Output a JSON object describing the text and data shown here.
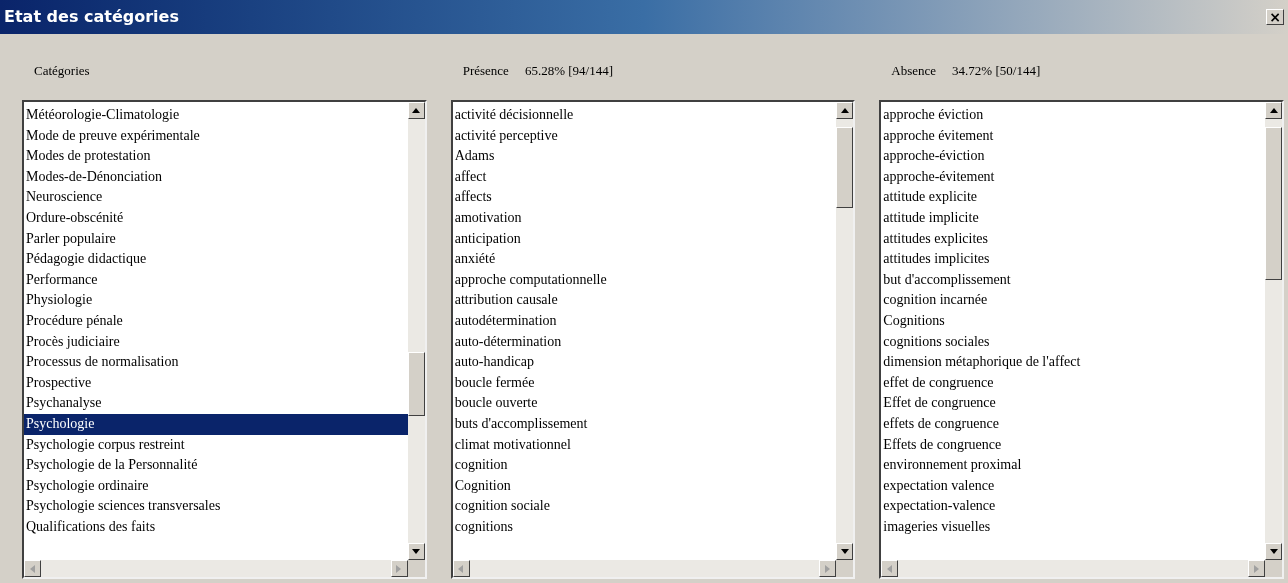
{
  "window": {
    "title": "Etat des catégories",
    "close": "×"
  },
  "panels": [
    {
      "label": "Catégories",
      "items": [
        {
          "text": "Météorologie-Climatologie",
          "selected": false
        },
        {
          "text": "Mode de preuve expérimentale",
          "selected": false
        },
        {
          "text": "Modes de protestation",
          "selected": false
        },
        {
          "text": "Modes-de-Dénonciation",
          "selected": false
        },
        {
          "text": "Neuroscience",
          "selected": false
        },
        {
          "text": "Ordure-obscénité",
          "selected": false
        },
        {
          "text": "Parler populaire",
          "selected": false
        },
        {
          "text": "Pédagogie didactique",
          "selected": false
        },
        {
          "text": "Performance",
          "selected": false
        },
        {
          "text": "Physiologie",
          "selected": false
        },
        {
          "text": "Procédure pénale",
          "selected": false
        },
        {
          "text": "Procès judiciaire",
          "selected": false
        },
        {
          "text": "Processus de normalisation",
          "selected": false
        },
        {
          "text": "Prospective",
          "selected": false
        },
        {
          "text": "Psychanalyse",
          "selected": false
        },
        {
          "text": "Psychologie",
          "selected": true
        },
        {
          "text": "Psychologie corpus restreint",
          "selected": false
        },
        {
          "text": "Psychologie de la Personnalité",
          "selected": false
        },
        {
          "text": "Psychologie ordinaire",
          "selected": false
        },
        {
          "text": "Psychologie sciences transversales",
          "selected": false
        },
        {
          "text": "Qualifications des faits",
          "selected": false
        }
      ]
    },
    {
      "label": "Présence",
      "stat": "65.28% [94/144]",
      "items": [
        {
          "text": "activité décisionnelle"
        },
        {
          "text": "activité perceptive"
        },
        {
          "text": "Adams"
        },
        {
          "text": "affect"
        },
        {
          "text": "affects"
        },
        {
          "text": "amotivation"
        },
        {
          "text": "anticipation"
        },
        {
          "text": "anxiété"
        },
        {
          "text": "approche computationnelle"
        },
        {
          "text": "attribution causale"
        },
        {
          "text": "autodétermination"
        },
        {
          "text": "auto-détermination"
        },
        {
          "text": "auto-handicap"
        },
        {
          "text": "boucle fermée"
        },
        {
          "text": "boucle ouverte"
        },
        {
          "text": "buts d'accomplissement"
        },
        {
          "text": "climat motivationnel"
        },
        {
          "text": "cognition"
        },
        {
          "text": "Cognition"
        },
        {
          "text": "cognition sociale"
        },
        {
          "text": "cognitions"
        }
      ]
    },
    {
      "label": "Absence",
      "stat": "34.72% [50/144]",
      "items": [
        {
          "text": "approche éviction"
        },
        {
          "text": "approche évitement"
        },
        {
          "text": "approche-éviction"
        },
        {
          "text": "approche-évitement"
        },
        {
          "text": "attitude explicite"
        },
        {
          "text": "attitude implicite"
        },
        {
          "text": "attitudes explicites"
        },
        {
          "text": "attitudes implicites"
        },
        {
          "text": "but d'accomplissement"
        },
        {
          "text": "cognition incarnée"
        },
        {
          "text": "Cognitions"
        },
        {
          "text": "cognitions sociales"
        },
        {
          "text": "dimension métaphorique de l'affect"
        },
        {
          "text": "effet de congruence"
        },
        {
          "text": "Effet de congruence"
        },
        {
          "text": "effets de congruence"
        },
        {
          "text": "Effets de congruence"
        },
        {
          "text": "environnement proximal"
        },
        {
          "text": "expectation valence"
        },
        {
          "text": "expectation-valence"
        },
        {
          "text": "imageries visuelles"
        }
      ]
    }
  ]
}
